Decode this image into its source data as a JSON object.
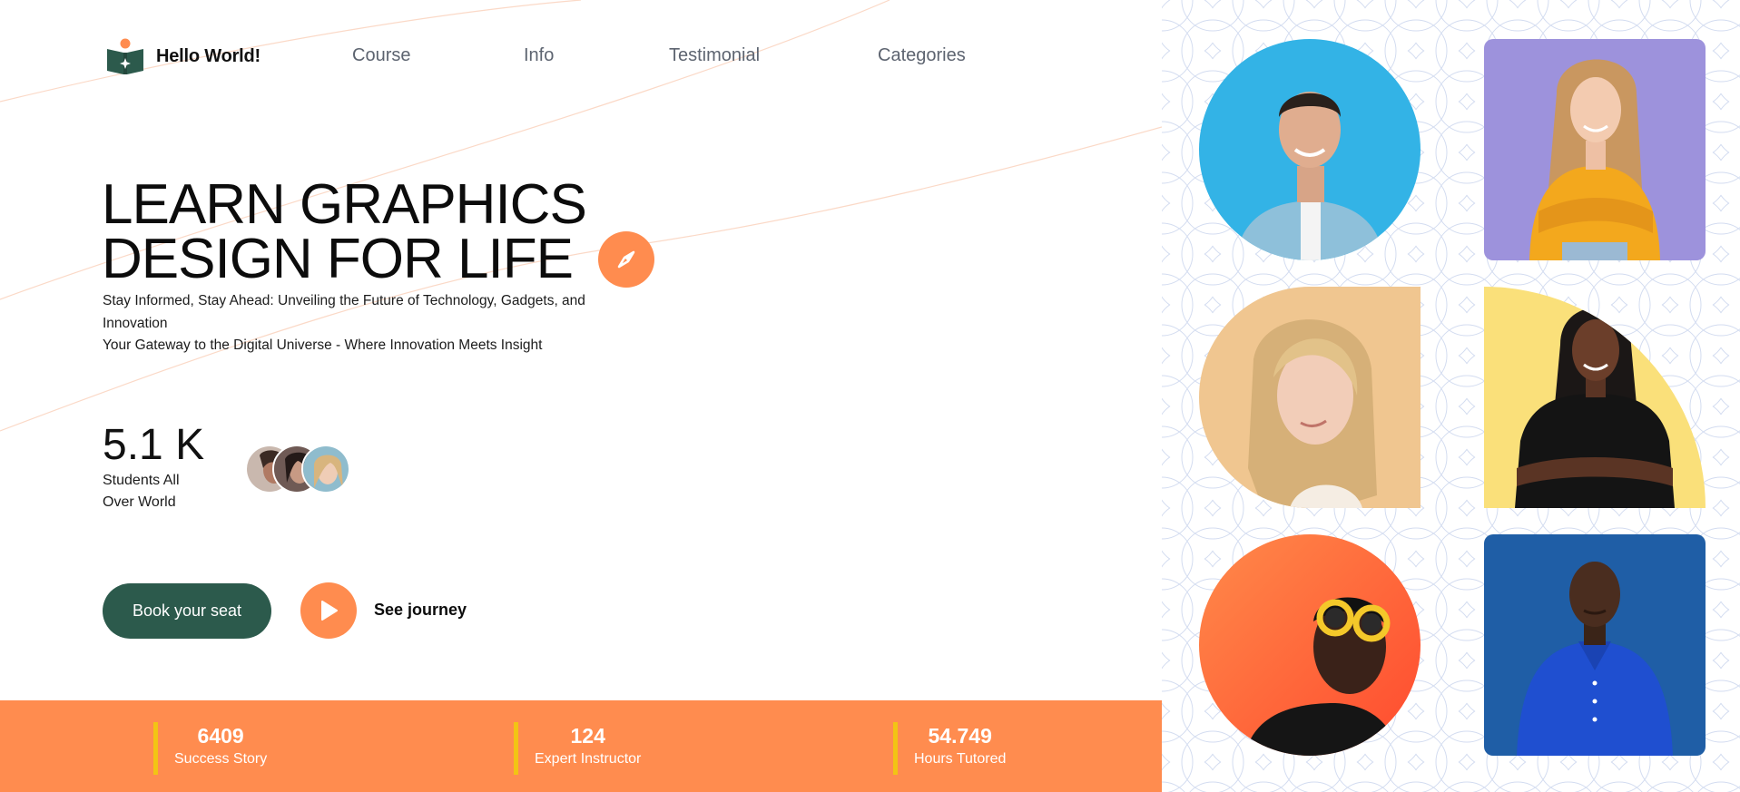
{
  "brand": {
    "name": "Hello World!",
    "logo_icon": "book-star-icon"
  },
  "nav": {
    "items": [
      "Course",
      "Info",
      "Testimonial",
      "Categories"
    ]
  },
  "hero": {
    "title_line1": "LEARN GRAPHICS",
    "title_line2": "DESIGN FOR LIFE",
    "badge_icon": "compass-icon",
    "subtitle_line1": "Stay Informed, Stay Ahead: Unveiling the Future of Technology, Gadgets, and Innovation",
    "subtitle_line2": "Your Gateway to the Digital Universe - Where Innovation Meets Insight"
  },
  "students": {
    "count": "5.1 K",
    "label_line1": "Students All",
    "label_line2": "Over World"
  },
  "cta": {
    "book_label": "Book your seat",
    "journey_label": "See journey",
    "play_icon": "play-icon"
  },
  "stats": [
    {
      "value": "6409",
      "label": "Success Story"
    },
    {
      "value": "124",
      "label": "Expert Instructor"
    },
    {
      "value": "54.749",
      "label": "Hours Tutored"
    }
  ],
  "colors": {
    "accent_orange": "#ff8c4f",
    "primary_green": "#2c5a4c",
    "stat_divider": "#f2c414",
    "tile_blue": "#33b3e6",
    "tile_lavender": "#9d92dc",
    "tile_peach": "#f0c690",
    "tile_yellow": "#fae07a",
    "tile_red_orange": "#ff5a32",
    "tile_navy": "#1f5ea6"
  }
}
